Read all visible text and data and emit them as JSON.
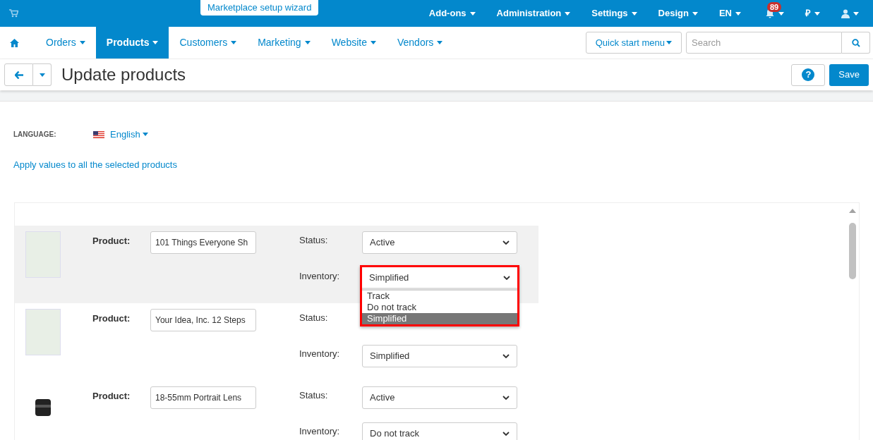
{
  "top_bar": {
    "wizard_button": "Marketplace setup wizard",
    "menus": [
      {
        "kind": "text",
        "label": "Add-ons"
      },
      {
        "kind": "text",
        "label": "Administration"
      },
      {
        "kind": "text",
        "label": "Settings"
      },
      {
        "kind": "text",
        "label": "Design"
      },
      {
        "kind": "text",
        "label": "EN"
      },
      {
        "kind": "bell",
        "badge": "89"
      },
      {
        "kind": "text",
        "label": "₽"
      },
      {
        "kind": "user"
      }
    ]
  },
  "nav": {
    "tabs": [
      {
        "label": "Orders",
        "selected": false
      },
      {
        "label": "Products",
        "selected": true
      },
      {
        "label": "Customers",
        "selected": false
      },
      {
        "label": "Marketing",
        "selected": false
      },
      {
        "label": "Website",
        "selected": false
      },
      {
        "label": "Vendors",
        "selected": false
      }
    ],
    "quick_start": "Quick start menu",
    "search": {
      "placeholder": "Search"
    }
  },
  "title_bar": {
    "title": "Update products",
    "help": "?",
    "save": "Save"
  },
  "language": {
    "label": "LANGUAGE:",
    "value": "English"
  },
  "apply_link": "Apply values to all the selected products",
  "products": [
    {
      "kind": "book",
      "highlighted": true,
      "product_label": "Product:",
      "product": "101 Things Everyone Sh",
      "status_label": "Status:",
      "status": "Active",
      "inventory_label": "Inventory:",
      "inventory": "Simplified",
      "open_options": [
        {
          "label": "Track",
          "selected": false
        },
        {
          "label": "Do not track",
          "selected": false
        },
        {
          "label": "Simplified",
          "selected": true
        }
      ]
    },
    {
      "kind": "book",
      "highlighted": false,
      "product_label": "Product:",
      "product": "Your Idea, Inc. 12 Steps",
      "status_label": "Status:",
      "inventory_label": "Inventory:",
      "inventory": "Simplified"
    },
    {
      "kind": "lens",
      "highlighted": false,
      "product_label": "Product:",
      "product": "18-55mm Portrait Lens",
      "status_label": "Status:",
      "status": "Active",
      "inventory_label": "Inventory:",
      "inventory": "Do not track"
    }
  ]
}
